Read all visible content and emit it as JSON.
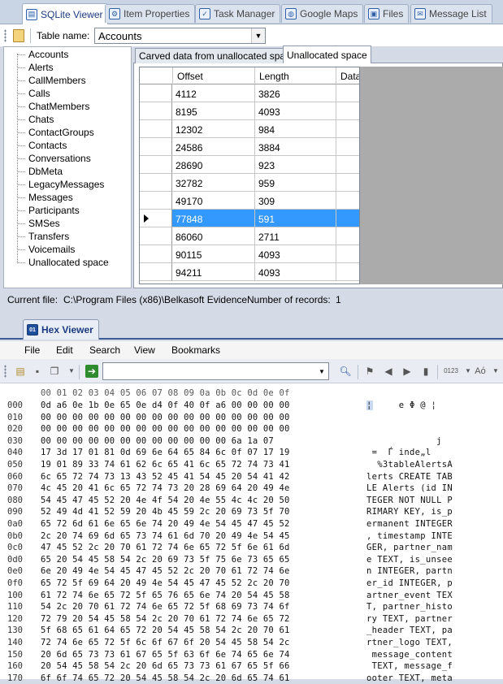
{
  "top_tabs": [
    {
      "label": "SQLite Viewer",
      "icon": "database-icon",
      "active": true
    },
    {
      "label": "Item Properties",
      "icon": "gears-icon",
      "active": false
    },
    {
      "label": "Task Manager",
      "icon": "checkbox-icon",
      "active": false
    },
    {
      "label": "Google Maps",
      "icon": "globe-icon",
      "active": false
    },
    {
      "label": "Files",
      "icon": "files-icon",
      "active": false
    },
    {
      "label": "Message List",
      "icon": "message-icon",
      "active": false
    }
  ],
  "sqlite_toolbar": {
    "table_name_label": "Table name:",
    "table_name_value": "Accounts"
  },
  "table_list": [
    "Accounts",
    "Alerts",
    "CallMembers",
    "Calls",
    "ChatMembers",
    "Chats",
    "ContactGroups",
    "Contacts",
    "Conversations",
    "DbMeta",
    "LegacyMessages",
    "Messages",
    "Participants",
    "SMSes",
    "Transfers",
    "Voicemails",
    "Unallocated space"
  ],
  "sub_tabs": [
    {
      "label": "Carved data from unallocated space",
      "active": false
    },
    {
      "label": "Unallocated space",
      "active": true
    }
  ],
  "grid": {
    "columns": [
      "Offset",
      "Length",
      "Data"
    ],
    "rows": [
      [
        "4112",
        "3826"
      ],
      [
        "8195",
        "4093"
      ],
      [
        "12302",
        "984"
      ],
      [
        "24586",
        "3884"
      ],
      [
        "28690",
        "923"
      ],
      [
        "32782",
        "959"
      ],
      [
        "49170",
        "309"
      ],
      [
        "77848",
        "591"
      ],
      [
        "86060",
        "2711"
      ],
      [
        "90115",
        "4093"
      ],
      [
        "94211",
        "4093"
      ]
    ],
    "selected_index": 7
  },
  "status": {
    "current_file_label": "Current file:",
    "current_file_value": "C:\\Program Files (x86)\\Belkasoft Evidence",
    "records_label": "Number of records:",
    "records_value": "1"
  },
  "hex_viewer": {
    "tab_label": "Hex Viewer",
    "tab_icon": "hex-grid-icon",
    "menu": [
      "File",
      "Edit",
      "Search",
      "View",
      "Bookmarks"
    ],
    "search_value": "",
    "header": "00 01 02 03 04 05 06 07 08 09 0a 0b 0c 0d 0e 0f",
    "rows": [
      {
        "offset": "000",
        "hex": "0d a6 0e 1b 0e 65 0e d4 0f 40 0f a6 00 00 00 00",
        "ascii": "¦     e Φ @ ¦"
      },
      {
        "offset": "010",
        "hex": "00 00 00 00 00 00 00 00 00 00 00 00 00 00 00 00",
        "ascii": ""
      },
      {
        "offset": "020",
        "hex": "00 00 00 00 00 00 00 00 00 00 00 00 00 00 00 00",
        "ascii": ""
      },
      {
        "offset": "030",
        "hex": "00 00 00 00 00 00 00 00 00 00 00 00 6a 1a 07",
        "ascii": "             j"
      },
      {
        "offset": "040",
        "hex": "17 3d 17 01 81 0d 69 6e 64 65 84 6c 0f 07 17 19",
        "ascii": " =  Ѓ inde„l"
      },
      {
        "offset": "050",
        "hex": "19 01 89 33 74 61 62 6c 65 41 6c 65 72 74 73 41",
        "ascii": "  %3tableAlertsA"
      },
      {
        "offset": "060",
        "hex": "6c 65 72 74 73 13 43 52 45 41 54 45 20 54 41 42",
        "ascii": "lerts CREATE TAB"
      },
      {
        "offset": "070",
        "hex": "4c 45 20 41 6c 65 72 74 73 20 28 69 64 20 49 4e",
        "ascii": "LE Alerts (id IN"
      },
      {
        "offset": "080",
        "hex": "54 45 47 45 52 20 4e 4f 54 20 4e 55 4c 4c 20 50",
        "ascii": "TEGER NOT NULL P"
      },
      {
        "offset": "090",
        "hex": "52 49 4d 41 52 59 20 4b 45 59 2c 20 69 73 5f 70",
        "ascii": "RIMARY KEY, is_p"
      },
      {
        "offset": "0a0",
        "hex": "65 72 6d 61 6e 65 6e 74 20 49 4e 54 45 47 45 52",
        "ascii": "ermanent INTEGER"
      },
      {
        "offset": "0b0",
        "hex": "2c 20 74 69 6d 65 73 74 61 6d 70 20 49 4e 54 45",
        "ascii": ", timestamp INTE"
      },
      {
        "offset": "0c0",
        "hex": "47 45 52 2c 20 70 61 72 74 6e 65 72 5f 6e 61 6d",
        "ascii": "GER, partner_nam"
      },
      {
        "offset": "0d0",
        "hex": "65 20 54 45 58 54 2c 20 69 73 5f 75 6e 73 65 65",
        "ascii": "e TEXT, is_unsee"
      },
      {
        "offset": "0e0",
        "hex": "6e 20 49 4e 54 45 47 45 52 2c 20 70 61 72 74 6e",
        "ascii": "n INTEGER, partn"
      },
      {
        "offset": "0f0",
        "hex": "65 72 5f 69 64 20 49 4e 54 45 47 45 52 2c 20 70",
        "ascii": "er_id INTEGER, p"
      },
      {
        "offset": "100",
        "hex": "61 72 74 6e 65 72 5f 65 76 65 6e 74 20 54 45 58",
        "ascii": "artner_event TEX"
      },
      {
        "offset": "110",
        "hex": "54 2c 20 70 61 72 74 6e 65 72 5f 68 69 73 74 6f",
        "ascii": "T, partner_histo"
      },
      {
        "offset": "120",
        "hex": "72 79 20 54 45 58 54 2c 20 70 61 72 74 6e 65 72",
        "ascii": "ry TEXT, partner"
      },
      {
        "offset": "130",
        "hex": "5f 68 65 61 64 65 72 20 54 45 58 54 2c 20 70 61",
        "ascii": "_header TEXT, pa"
      },
      {
        "offset": "140",
        "hex": "72 74 6e 65 72 5f 6c 6f 67 6f 20 54 45 58 54 2c",
        "ascii": "rtner_logo TEXT,"
      },
      {
        "offset": "150",
        "hex": "20 6d 65 73 73 61 67 65 5f 63 6f 6e 74 65 6e 74",
        "ascii": " message_content"
      },
      {
        "offset": "160",
        "hex": "20 54 45 58 54 2c 20 6d 65 73 73 61 67 65 5f 66",
        "ascii": " TEXT, message_f"
      },
      {
        "offset": "170",
        "hex": "6f 6f 74 65 72 20 54 45 58 54 2c 20 6d 65 74 61",
        "ascii": "ooter TEXT, meta"
      }
    ]
  },
  "colors": {
    "selection": "#3399ff",
    "accent": "#1a3a80"
  }
}
